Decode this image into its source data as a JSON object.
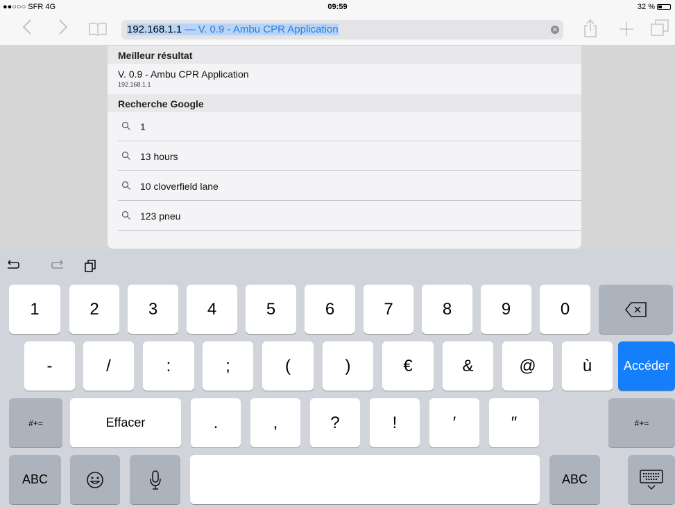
{
  "status": {
    "carrier": "●●○○○ SFR  4G",
    "time": "09:59",
    "battery": "32 %"
  },
  "toolbar": {
    "url_host": "192.168.1.1",
    "url_title": " — V. 0.9 - Ambu CPR Application",
    "clear_icon": "✕"
  },
  "suggestions": {
    "best_header": "Meilleur résultat",
    "best_title": "V. 0.9 - Ambu CPR Application",
    "best_url": "192.168.1.1",
    "google_header": "Recherche Google",
    "items": [
      "1",
      "13 hours",
      "10 cloverfield lane",
      "123 pneu"
    ]
  },
  "keyboard": {
    "row1": [
      "1",
      "2",
      "3",
      "4",
      "5",
      "6",
      "7",
      "8",
      "9",
      "0"
    ],
    "row2": [
      "-",
      "/",
      ":",
      ";",
      "(",
      ")",
      "€",
      "&",
      "@",
      "ù"
    ],
    "go_label": "Accéder",
    "row3_left": "#+=",
    "row3_right": "#+=",
    "effacer": "Effacer",
    "row3": [
      ".",
      ",",
      "?",
      "!",
      "′",
      "″"
    ],
    "abc_left": "ABC",
    "abc_right": "ABC",
    "emoji": "☺",
    "mic": "🎙",
    "hide": "⌨"
  },
  "colors": {
    "accent": "#157efb",
    "selection": "#b8d4f6"
  }
}
